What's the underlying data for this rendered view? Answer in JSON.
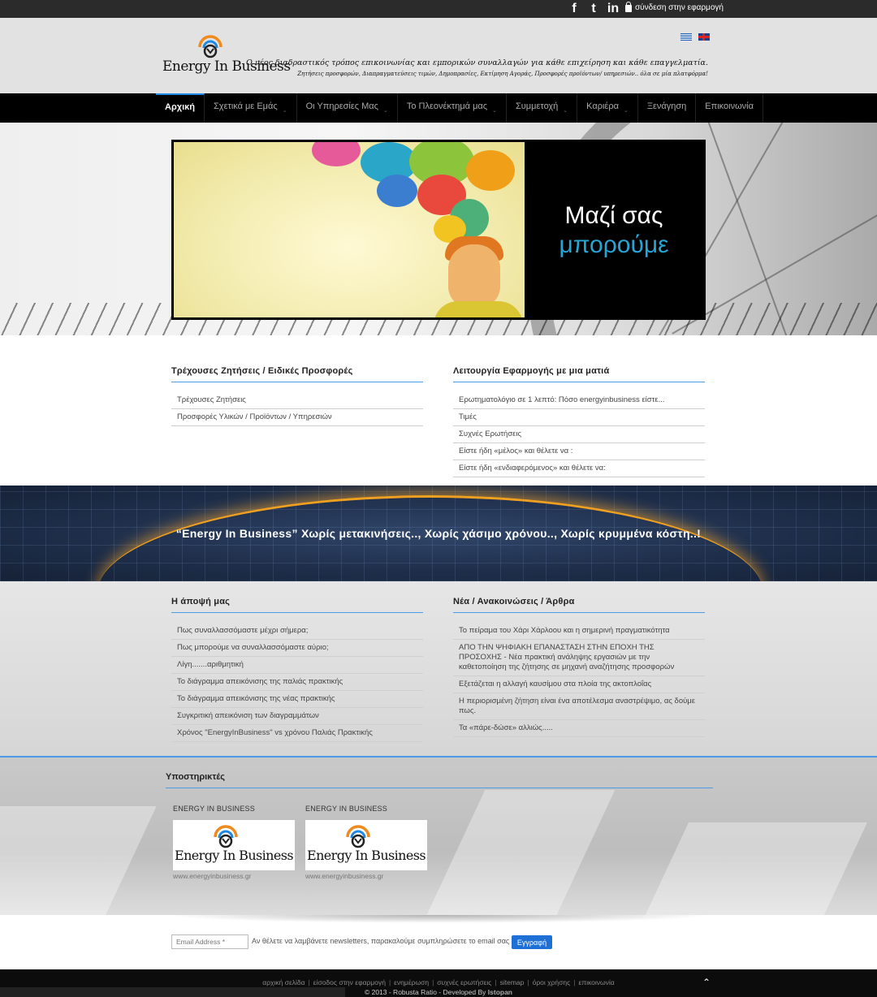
{
  "topbar": {
    "social": [
      {
        "icon": "facebook-icon",
        "glyph": "f"
      },
      {
        "icon": "twitter-icon",
        "glyph": "t"
      },
      {
        "icon": "linkedin-icon",
        "glyph": "in"
      }
    ],
    "login_label": "σύνδεση στην εφαρμογή"
  },
  "header": {
    "logo_text": "Energy In Business",
    "tagline": "Ο νέος διαδραστικός τρόπος επικοινωνίας και εμπορικών συναλλαγών για κάθε επιχείρηση και κάθε επαγγελματία.",
    "subtagline": "Ζητήσεις προσφορών, Διαπραγματεύσεις τιμών, Δημοπρασίες, Εκτίμηση Αγοράς, Προσφορές προϊόντων/ υπηρεσιών.. όλα σε μία πλατφόρμα!"
  },
  "nav": {
    "items": [
      {
        "label": "Αρχική",
        "active": true,
        "caret": false
      },
      {
        "label": "Σχετικά με Εμάς",
        "active": false,
        "caret": true
      },
      {
        "label": "Οι Υπηρεσίες Μας",
        "active": false,
        "caret": true
      },
      {
        "label": "Το Πλεονέκτημά μας",
        "active": false,
        "caret": true
      },
      {
        "label": "Συμμετοχή",
        "active": false,
        "caret": true
      },
      {
        "label": "Καριέρα",
        "active": false,
        "caret": true
      },
      {
        "label": "Ξενάγηση",
        "active": false,
        "caret": false
      },
      {
        "label": "Επικοινωνία",
        "active": false,
        "caret": false
      }
    ]
  },
  "hero": {
    "caption_line1": "Μαζί σας",
    "caption_line2": "μπορούμε",
    "accent_color": "#27a6d6"
  },
  "offers": {
    "title": "Τρέχουσες Ζητήσεις / Ειδικές Προσφορές",
    "items": [
      "Τρέχουσες Ζητήσεις",
      "Προσφορές Υλικών / Προϊόντων / Υπηρεσιών"
    ]
  },
  "overview": {
    "title": "Λειτουργία Εφαρμογής με μια ματιά",
    "items": [
      "Ερωτηματολόγιο σε 1 λεπτό: Πόσο energyinbusiness είστε...",
      "Τιμές",
      "Συχνές Ερωτήσεις",
      "Είστε ήδη «μέλος» και θέλετε να :",
      "Είστε ήδη «ενδιαφερόμενος» και θέλετε να:"
    ]
  },
  "banner": {
    "text": "“Energy In Business” Χωρίς μετακινήσεις.., Χωρίς χάσιμο χρόνου.., Χωρίς κρυμμένα κόστη..!"
  },
  "opinion": {
    "title": "Η άποψή μας",
    "items": [
      "Πως συναλλασσόμαστε μέχρι σήμερα;",
      "Πως μπορούμε να συναλλασσόμαστε αύριο;",
      "Λίγη.......αριθμητική",
      "Το διάγραμμα απεικόνισης της παλιάς πρακτικής",
      "Το διάγραμμα απεικόνισης της νέας πρακτικής",
      "Συγκριτική απεικόνιση των διαγραμμάτων",
      "Χρόνος \"EnergyInBusiness\" vs χρόνου Παλιάς Πρακτικής"
    ]
  },
  "news": {
    "title": "Νέα / Ανακοινώσεις / Άρθρα",
    "items": [
      "Το πείραμα του Χάρι Χάρλοου και η σημερινή πραγματικότητα",
      "ΑΠΟ ΤΗΝ ΨΗΦΙΑΚΗ ΕΠΑΝΑΣΤΑΣΗ ΣΤΗΝ ΕΠΟΧΗ ΤΗΣ ΠΡΟΣΟΧΗΣ - Νέα πρακτική ανάληψης εργασιών με την καθετοποίηση της ζήτησης σε μηχανή αναζήτησης προσφορών",
      "Εξετάζεται η αλλαγή καυσίμου στα πλοία της ακτοπλοΐας",
      "Η περιορισμένη ζήτηση είναι ένα αποτέλεσμα αναστρέψιμο, ας δούμε πως.",
      "Τα «πάρε-δώσε» αλλιώς....."
    ]
  },
  "sponsors": {
    "title": "Υποστηρικτές",
    "items": [
      {
        "name": "ENERGY IN BUSINESS",
        "logo_text": "Energy In Business",
        "url": "www.energyinbusiness.gr"
      },
      {
        "name": "ENERGY IN BUSINESS",
        "logo_text": "Energy In Business",
        "url": "www.energyinbusiness.gr"
      }
    ]
  },
  "newsletter": {
    "placeholder": "Email Address *",
    "hint": "Αν θέλετε να λαμβάνετε newsletters, παρακαλούμε συμπληρώσετε το email σας",
    "button_label": "Εγγραφή"
  },
  "footer": {
    "links": [
      "αρχική σελίδα",
      "είσοδος στην εφαρμογή",
      "ενημέρωση",
      "συχνές ερωτήσεις",
      "sitemap",
      "όροι χρήσης",
      "επικοινωνία"
    ],
    "separator": "|",
    "copyright": "© 2013 - Robusta Ratio - Developed By",
    "developer": "Istopan"
  }
}
